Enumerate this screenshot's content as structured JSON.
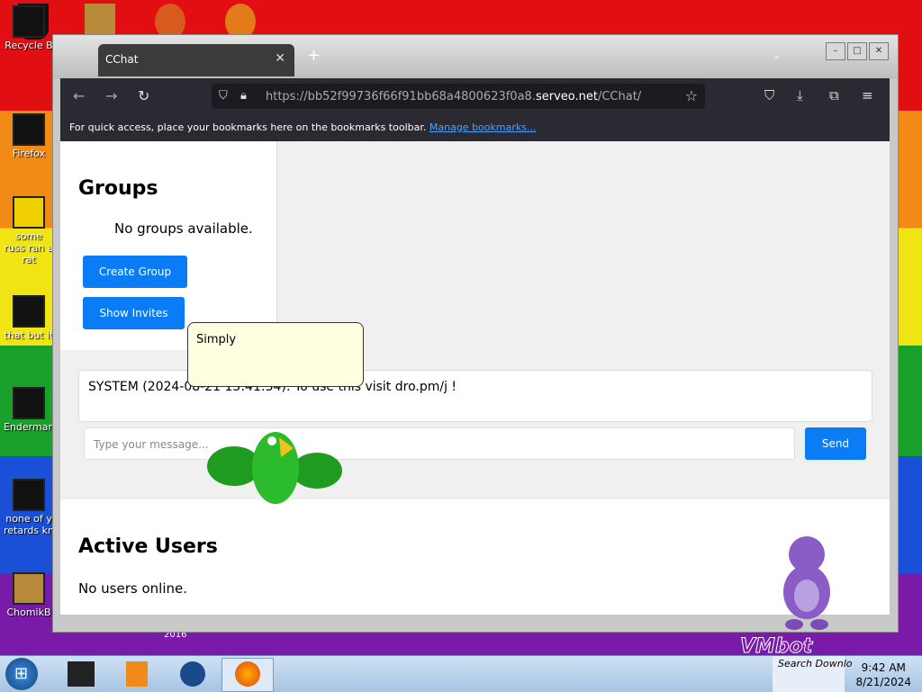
{
  "desktop": {
    "icons": [
      {
        "label": "Recycle B"
      },
      {
        "label": "Firefox"
      },
      {
        "label": "some russ ran a rat"
      },
      {
        "label": "that but it"
      },
      {
        "label": "Enderman"
      },
      {
        "label": "none of y retards kn"
      },
      {
        "label": "ChomikB"
      }
    ],
    "small_caption": "2016"
  },
  "browser": {
    "tab_title": "CChat",
    "tab_close": "✕",
    "new_tab": "+",
    "url": {
      "prefix": "https://",
      "host_dim": "bb52f99736f66f91bb68a4800623f0a8.",
      "host": "serveo.net",
      "path": "/CChat/"
    },
    "bookmarks_text": "For quick access, place your bookmarks here on the bookmarks toolbar.",
    "bookmarks_link": "Manage bookmarks..."
  },
  "page": {
    "groups_title": "Groups",
    "groups_empty": "No groups available.",
    "create_group": "Create Group",
    "show_invites": "Show Invites",
    "system_message": "SYSTEM (2024-08-21 15:41:34): To use this visit dro.pm/j !",
    "message_placeholder": "Type your message...",
    "send": "Send",
    "active_users_title": "Active Users",
    "active_users_empty": "No users online."
  },
  "overlay": {
    "bubble_text": "Simply",
    "vm_logo": "VMbot"
  },
  "taskbar": {
    "search_text": "Search Downlo",
    "time": "9:42 AM",
    "date": "8/21/2024"
  },
  "colors": {
    "accent": "#0a7cf5",
    "browser_dark": "#2b2a33"
  }
}
